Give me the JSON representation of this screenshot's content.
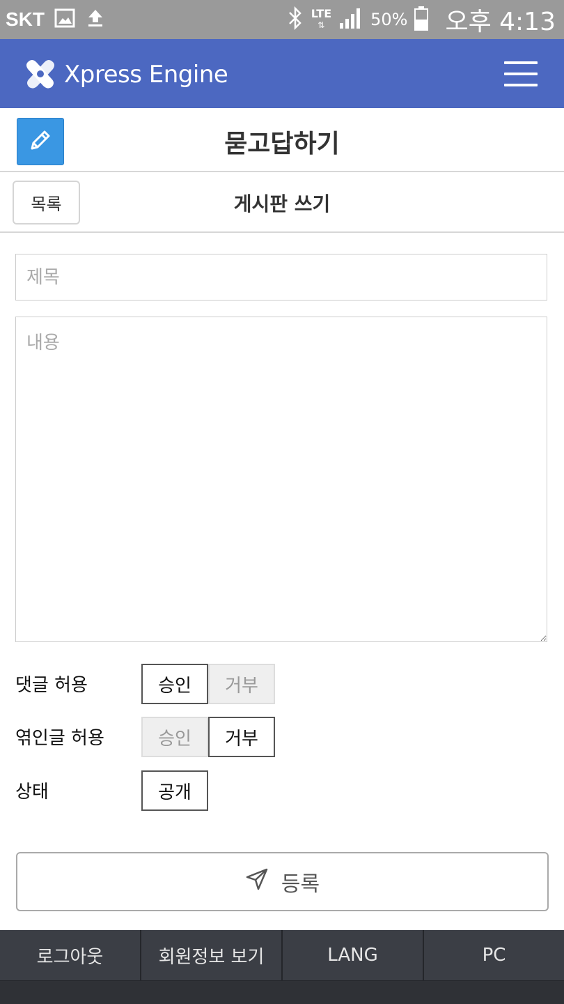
{
  "status_bar": {
    "carrier": "SKT",
    "network": "LTE",
    "battery": "50%",
    "time": "오후 4:13"
  },
  "header": {
    "logo_text": "Xpress Engine"
  },
  "page": {
    "title": "묻고답하기",
    "subtitle": "게시판 쓰기",
    "list_button": "목록"
  },
  "form": {
    "title_placeholder": "제목",
    "content_placeholder": "내용",
    "options": [
      {
        "label": "댓글 허용",
        "buttons": [
          "승인",
          "거부"
        ],
        "selected": "승인"
      },
      {
        "label": "엮인글 허용",
        "buttons": [
          "승인",
          "거부"
        ],
        "selected": "거부"
      },
      {
        "label": "상태",
        "buttons": [
          "공개"
        ],
        "selected": "공개"
      }
    ],
    "submit_label": "등록"
  },
  "footer": {
    "items": [
      "로그아웃",
      "회원정보 보기",
      "LANG",
      "PC"
    ]
  },
  "colors": {
    "header_bg": "#4c68c1",
    "edit_icon_bg": "#3a97e3",
    "footer_bg": "#3b3e45",
    "status_bar_bg": "#9a9a9a"
  }
}
